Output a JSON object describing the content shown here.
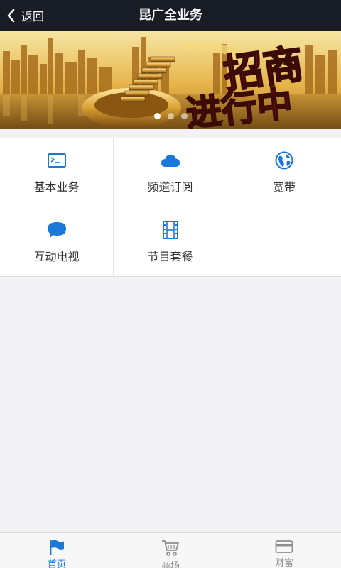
{
  "nav": {
    "back_label": "返回",
    "title": "昆广全业务"
  },
  "banner": {
    "slogan_1": "招商",
    "slogan_2": "进行中",
    "page_count": 3,
    "active_index": 0
  },
  "grid": {
    "items": [
      {
        "label": "基本业务",
        "icon": "terminal-icon"
      },
      {
        "label": "频道订阅",
        "icon": "cloud-icon"
      },
      {
        "label": "宽带",
        "icon": "globe-icon"
      },
      {
        "label": "互动电视",
        "icon": "chat-bubble-icon"
      },
      {
        "label": "节目套餐",
        "icon": "film-icon"
      }
    ]
  },
  "tabs": [
    {
      "label": "首页",
      "icon": "flag-icon",
      "active": true
    },
    {
      "label": "商场",
      "icon": "cart-icon",
      "active": false
    },
    {
      "label": "财富",
      "icon": "card-icon",
      "active": false
    }
  ],
  "colors": {
    "accent": "#1a78d8",
    "navbar": "#181c24",
    "background": "#f2f2f4"
  }
}
